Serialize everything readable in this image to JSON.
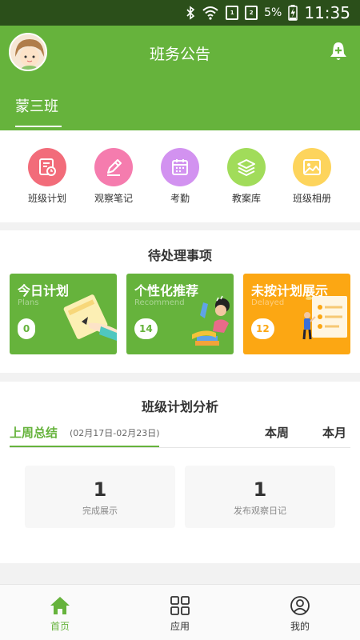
{
  "status_bar": {
    "battery": "5%",
    "time": "11:35"
  },
  "header": {
    "title": "班务公告",
    "class_tab": "蒙三班"
  },
  "quick_menu": [
    {
      "label": "班级计划",
      "icon": "calendar-clock-icon",
      "color": "#f26c7a"
    },
    {
      "label": "观察笔记",
      "icon": "pencil-icon",
      "color": "#f57cae"
    },
    {
      "label": "考勤",
      "icon": "calendar-icon",
      "color": "#d292f0"
    },
    {
      "label": "教案库",
      "icon": "layers-icon",
      "color": "#a1dc5a"
    },
    {
      "label": "班级相册",
      "icon": "image-icon",
      "color": "#fdd45c"
    }
  ],
  "pending": {
    "title": "待处理事项",
    "cards": [
      {
        "title": "今日计划",
        "subtitle": "Plans",
        "count": "0",
        "color": "#66b33c"
      },
      {
        "title": "个性化推荐",
        "subtitle": "Recommend",
        "count": "14",
        "color": "#66b33c"
      },
      {
        "title": "未按计划展示",
        "subtitle": "Delayed",
        "count": "12",
        "color": "#fca713"
      }
    ]
  },
  "analysis": {
    "title": "班级计划分析",
    "tabs": {
      "last_week": "上周总结",
      "date_range": "(02月17日-02月23日)",
      "this_week": "本周",
      "this_month": "本月"
    },
    "stats": [
      {
        "value": "1",
        "label": "完成展示"
      },
      {
        "value": "1",
        "label": "发布观察日记"
      }
    ]
  },
  "bottom_nav": [
    {
      "label": "首页",
      "icon": "home-icon",
      "active": true
    },
    {
      "label": "应用",
      "icon": "grid-icon",
      "active": false
    },
    {
      "label": "我的",
      "icon": "user-icon",
      "active": false
    }
  ],
  "colors": {
    "primary": "#66b33c",
    "accent_orange": "#fca713",
    "status_bar": "#2b4f1a"
  }
}
